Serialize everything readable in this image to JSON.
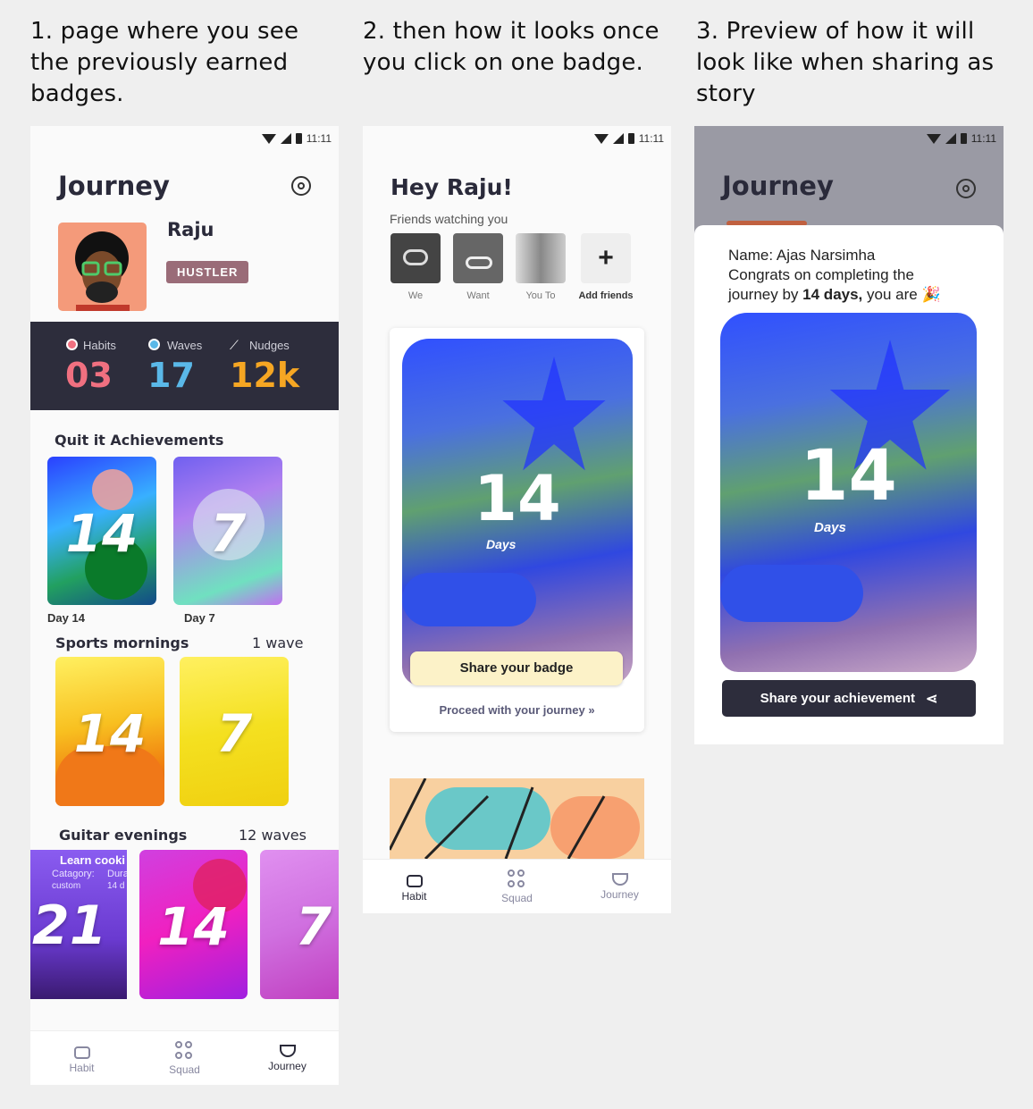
{
  "captions": {
    "c1": "1. page where you see the previously earned badges.",
    "c2": "2. then how it looks once you click on one badge.",
    "c3": "3. Preview of how it will look like when sharing as story"
  },
  "status": {
    "time": "11:11"
  },
  "screen1": {
    "title": "Journey",
    "user_name": "Raju",
    "user_tag": "HUSTLER",
    "stats": [
      {
        "label": "Habits",
        "value": "03",
        "color": "#f07080",
        "icon": "star-icon"
      },
      {
        "label": "Waves",
        "value": "17",
        "color": "#5ab8e8",
        "icon": "drop-icon"
      },
      {
        "label": "Nudges",
        "value": "12k",
        "color": "#f5a623",
        "icon": "nudge-icon"
      }
    ],
    "quit_title": "Quit it Achievements",
    "quit_cards": [
      {
        "num": "14",
        "caption": "Day 14"
      },
      {
        "num": "7",
        "caption": "Day 7"
      }
    ],
    "sports_title": "Sports mornings",
    "sports_count": "1 wave",
    "sports_cards": [
      {
        "num": "14"
      },
      {
        "num": "7"
      }
    ],
    "guitar_title": "Guitar evenings",
    "guitar_count": "12 waves",
    "guitar_cards": [
      {
        "num": "21",
        "line1": "Learn cooki",
        "line2a": "Catagory:",
        "line2b": "Dura",
        "line3a": "custom",
        "line3b": "14 d"
      },
      {
        "num": "14"
      },
      {
        "num": "7"
      }
    ]
  },
  "screen2": {
    "greeting": "Hey Raju!",
    "friends_label": "Friends watching you",
    "friends": [
      {
        "name": "We"
      },
      {
        "name": "Want"
      },
      {
        "name": "You To"
      },
      {
        "name": "Add friends"
      }
    ],
    "badge_num": "14",
    "badge_unit": "Days",
    "share_btn": "Share your badge",
    "proceed": "Proceed with your journey"
  },
  "screen3": {
    "title": "Journey",
    "name_line": "Name: Ajas Narsimha",
    "congrats1": "Congrats on completing the",
    "congrats2a": "journey by ",
    "congrats2b": "14 days,",
    "congrats2c": " you are",
    "badge_num": "14",
    "badge_unit": "Days",
    "share_btn": "Share your achievement"
  },
  "nav": {
    "habit": "Habit",
    "squad": "Squad",
    "journey": "Journey"
  }
}
